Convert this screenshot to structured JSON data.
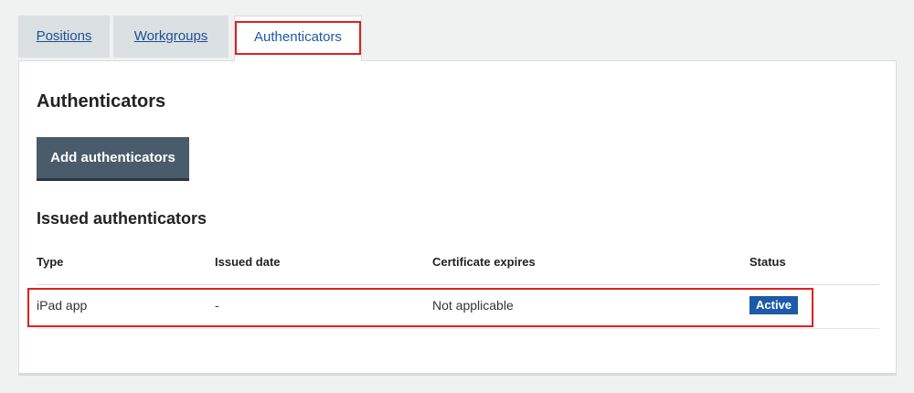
{
  "tabs": [
    {
      "label": "Positions",
      "active": false
    },
    {
      "label": "Workgroups",
      "active": false
    },
    {
      "label": "Authenticators",
      "active": true
    }
  ],
  "main": {
    "title": "Authenticators",
    "add_button_label": "Add authenticators",
    "issued_section_title": "Issued authenticators"
  },
  "table": {
    "columns": [
      "Type",
      "Issued date",
      "Certificate expires",
      "Status"
    ],
    "rows": [
      {
        "type": "iPad app",
        "issued_date": "-",
        "certificate_expires": "Not applicable",
        "status": "Active"
      }
    ]
  },
  "colors": {
    "accent": "#1d5aa8",
    "button": "#4a5c6b",
    "highlight": "#e02020",
    "status_active": "#1d5aa8"
  }
}
